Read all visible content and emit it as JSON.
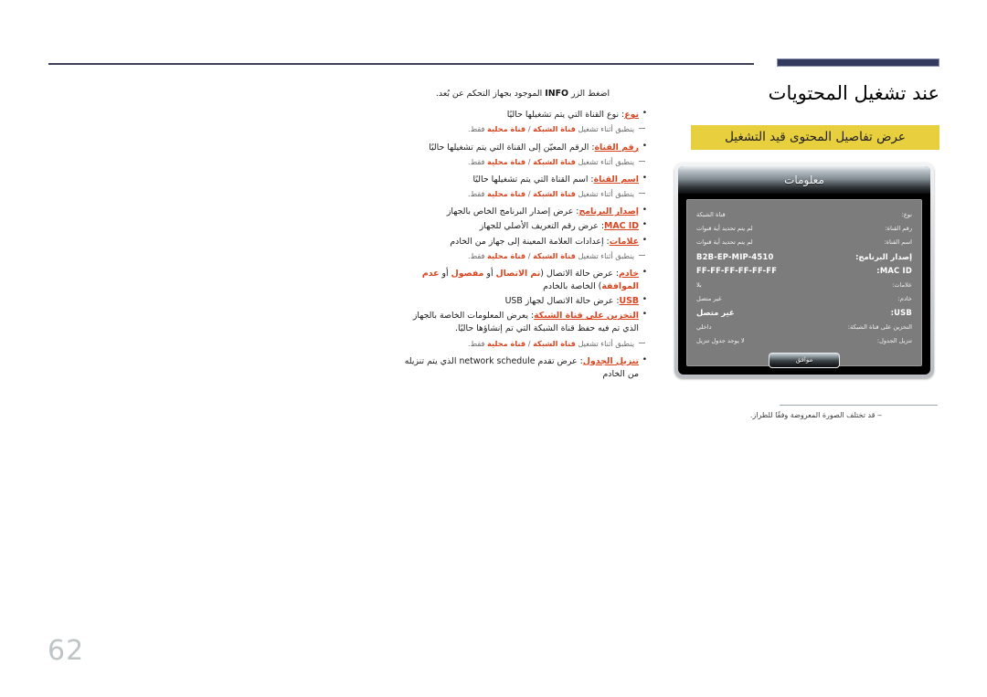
{
  "page": {
    "number": "62",
    "title": "عند تشغيل المحتويات",
    "highlight_banner": "عرض تفاصيل المحتوى قيد التشغيل",
    "footnote": "‒ قد تختلف الصورة المعروضة وفقًا للطراز.",
    "accent_color": "#d8451f",
    "banner_color": "#e8cf3e",
    "rule_color": "#343a5e"
  },
  "intro": {
    "text": "اضغط الزر INFO الموجود بجهاز التحكم عن بُعد."
  },
  "note_text": "ينطبق أثناء تشغيل قناة الشبكة / قناة محلية فقط.",
  "bullets": [
    {
      "term": "نوع",
      "text": ": نوع القناة التي يتم تشغيلها حاليًا",
      "has_note": true
    },
    {
      "term": "رقم القناة",
      "text": ": الرقم المعيّن إلى القناة التي يتم تشغيلها حاليًا",
      "has_note": true
    },
    {
      "term": "اسم القناة",
      "text": ": اسم القناة التي يتم تشغيلها حاليًا",
      "has_note": true
    },
    {
      "term": "إصدار البرنامج",
      "text": ": عرض إصدار البرنامج الخاص بالجهاز",
      "has_note": false
    },
    {
      "term": "MAC ID",
      "text": ": عرض رقم التعريف الأصلي للجهاز",
      "has_note": false
    },
    {
      "term": "علامات",
      "text": ": إعدادات العلامة المعينة إلى جهاز من الخادم",
      "has_note": true
    },
    {
      "term": "خادم",
      "text": ": عرض حالة الاتصال (تم الاتصال أو مفصول أو عدم الموافقة) الخاصة بالخادم",
      "has_note": false
    },
    {
      "term": "USB",
      "text": ": عرض حالة الاتصال لجهاز USB",
      "has_note": false
    },
    {
      "term": "التخزين على قناة الشبكة",
      "text": ": يعرض المعلومات الخاصة بالجهاز الذي تم فيه حفظ قناة الشبكة التي تم إنشاؤها حاليًا.",
      "has_note": true
    },
    {
      "term": "تنزيل الجدول",
      "text": ": عرض تقدم network schedule الذي يتم تنزيله من الخادم",
      "has_note": false
    }
  ],
  "device_dialog": {
    "title": "معلومات",
    "ok_label": "موافق",
    "rows": [
      {
        "label": "نوع:",
        "value": "قناة الشبكة",
        "mono": false
      },
      {
        "label": "رقم القناة:",
        "value": "لم يتم تحديد أية قنوات",
        "mono": false
      },
      {
        "label": "اسم القناة:",
        "value": "لم يتم تحديد أية قنوات",
        "mono": false
      },
      {
        "label": "إصدار البرنامج:",
        "value": "B2B-EP-MIP-4510",
        "mono": true
      },
      {
        "label": "MAC ID:",
        "value": "FF-FF-FF-FF-FF-FF",
        "mono": true
      },
      {
        "label": "علامات:",
        "value": "بلا",
        "mono": false
      },
      {
        "label": "خادم:",
        "value": "غير متصل",
        "mono": false
      },
      {
        "label": "USB:",
        "value": "غير متصل",
        "mono": true
      },
      {
        "label": "التخزين على قناة الشبكة:",
        "value": "داخلي",
        "mono": false
      },
      {
        "label": "تنزيل الجدول:",
        "value": "لا يوجد جدول تنزيل",
        "mono": false
      }
    ]
  }
}
